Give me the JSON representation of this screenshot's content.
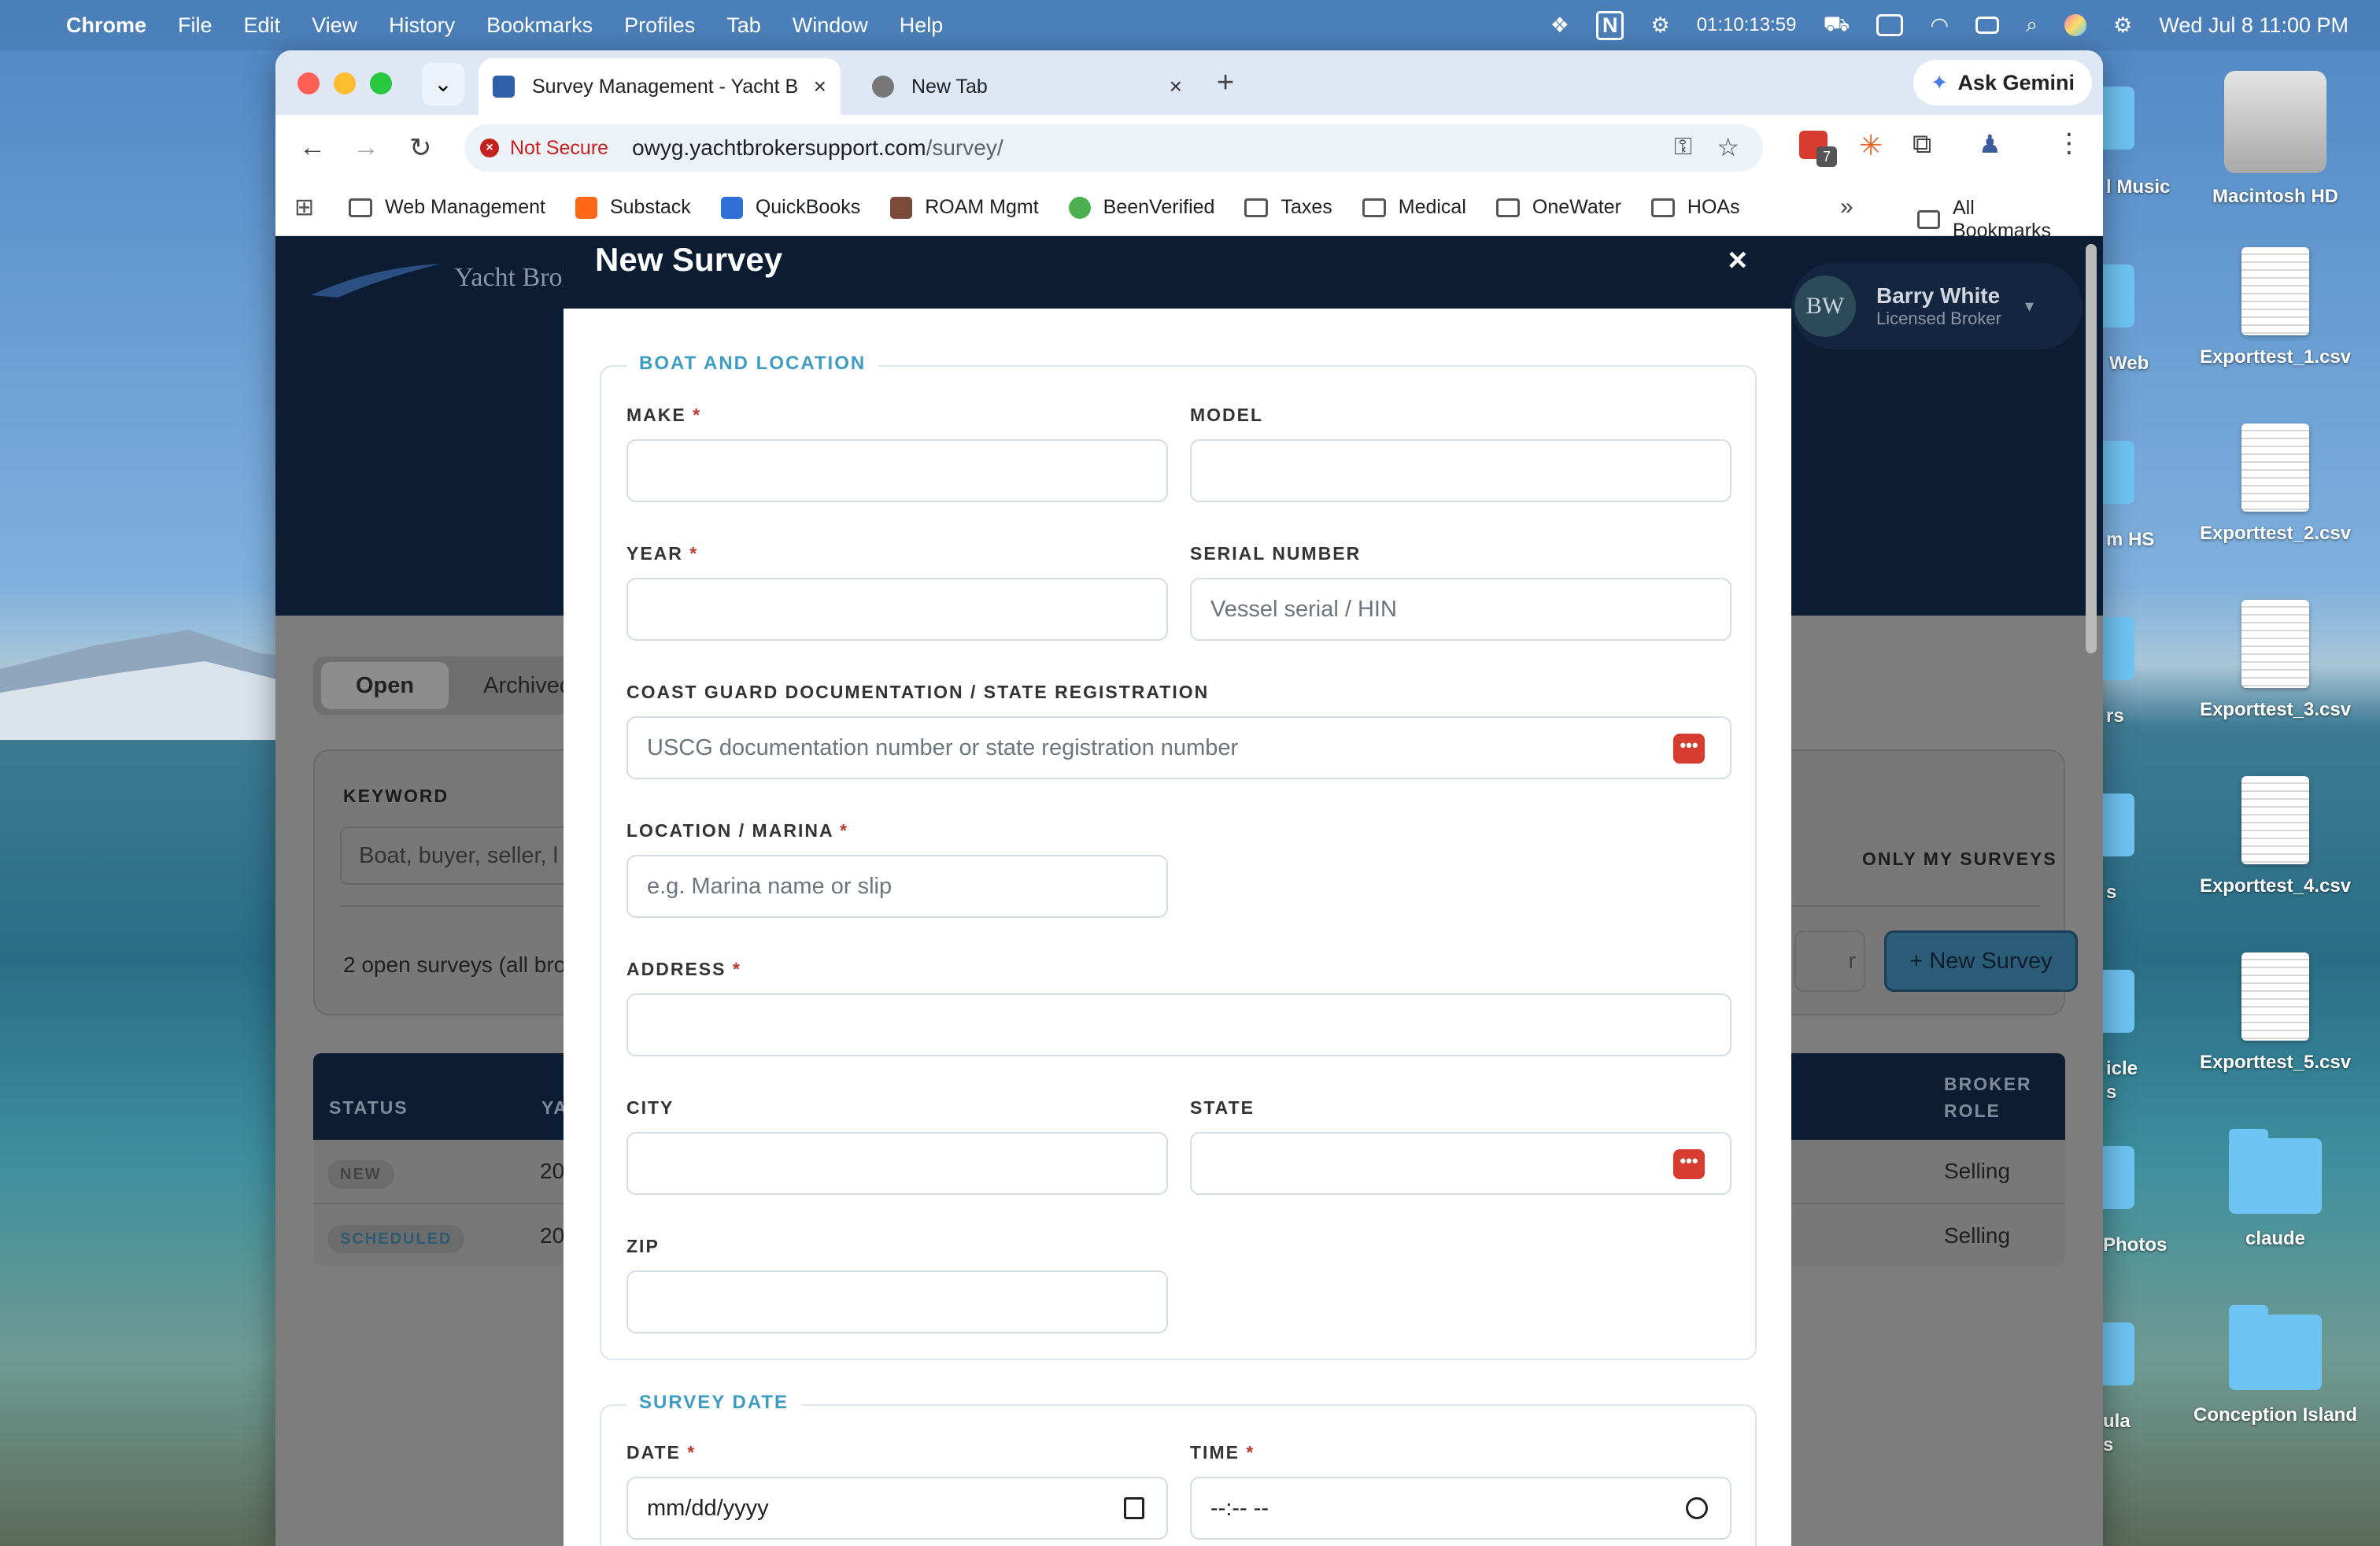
{
  "menubar": {
    "app": "Chrome",
    "items": [
      "File",
      "Edit",
      "View",
      "History",
      "Bookmarks",
      "Profiles",
      "Tab",
      "Window",
      "Help"
    ],
    "timer": "01:10:13:59",
    "datetime": "Wed Jul 8  11:00 PM"
  },
  "desktop": {
    "items": [
      {
        "label": "Macintosh HD",
        "icon": "hard-drive-icon"
      },
      {
        "label": "Exporttest_1.csv",
        "icon": "csv-file-icon"
      },
      {
        "label": "Exporttest_2.csv",
        "icon": "csv-file-icon"
      },
      {
        "label": "Exporttest_3.csv",
        "icon": "csv-file-icon"
      },
      {
        "label": "Exporttest_4.csv",
        "icon": "csv-file-icon"
      },
      {
        "label": "Exporttest_5.csv",
        "icon": "csv-file-icon"
      },
      {
        "label": "claude",
        "icon": "folder-icon"
      },
      {
        "label": "Conception Island",
        "icon": "folder-icon"
      }
    ],
    "peek_labels": [
      "l Music",
      "Web",
      "m HS",
      "rs",
      "s",
      "icle",
      "s",
      "Photos",
      "ula",
      "s"
    ]
  },
  "browser": {
    "tabs": [
      {
        "title": "Survey Management - Yacht B",
        "active": true
      },
      {
        "title": "New Tab",
        "active": false
      }
    ],
    "ask_gemini": "Ask Gemini",
    "security": "Not Secure",
    "url_host": "owyg.yachtbrokersupport.com",
    "url_path": "/survey/",
    "extension_badge": "7",
    "bookmarks": [
      {
        "label": "Web Management",
        "icon": "folder-icon"
      },
      {
        "label": "Substack",
        "icon": "substack-icon"
      },
      {
        "label": "QuickBooks",
        "icon": "quickbooks-icon"
      },
      {
        "label": "ROAM Mgmt",
        "icon": "roam-icon"
      },
      {
        "label": "BeenVerified",
        "icon": "beenverified-icon"
      },
      {
        "label": "Taxes",
        "icon": "folder-icon"
      },
      {
        "label": "Medical",
        "icon": "folder-icon"
      },
      {
        "label": "OneWater",
        "icon": "folder-icon"
      },
      {
        "label": "HOAs",
        "icon": "folder-icon"
      }
    ],
    "all_bookmarks": "All Bookmarks",
    "more_bookmarks": "»"
  },
  "background_page": {
    "brand": "Yacht Brol",
    "user": {
      "initials": "BW",
      "name": "Barry White",
      "role": "Licensed Broker"
    },
    "tabs": [
      "Open",
      "Archived"
    ],
    "keyword_label": "KEYWORD",
    "keyword_placeholder": "Boat, buyer, seller, l",
    "only_my_surveys": "ONLY MY SURVEYS",
    "count_text": "2 open surveys (all bro",
    "clear_partial": "r",
    "new_survey_button": "+ New Survey",
    "table": {
      "headers": {
        "status": "STATUS",
        "yacht": "YAC",
        "broker_role": "BROKER ROLE"
      },
      "rows": [
        {
          "status": "NEW",
          "year": "20",
          "broker_role": "Selling"
        },
        {
          "status": "SCHEDULED",
          "year": "20",
          "broker_role": "Selling"
        }
      ]
    }
  },
  "modal": {
    "title": "New Survey",
    "close": "×",
    "boat_section": {
      "legend": "BOAT AND LOCATION",
      "make": {
        "label": "MAKE",
        "value": "",
        "required": "*"
      },
      "model": {
        "label": "MODEL",
        "value": ""
      },
      "year": {
        "label": "YEAR",
        "value": "",
        "required": "*"
      },
      "serial": {
        "label": "SERIAL NUMBER",
        "placeholder": "Vessel serial / HIN"
      },
      "coast_guard": {
        "label": "COAST GUARD DOCUMENTATION / STATE REGISTRATION",
        "placeholder": "USCG documentation number or state registration number"
      },
      "location": {
        "label": "LOCATION / MARINA",
        "placeholder": "e.g. Marina name or slip",
        "required": "*"
      },
      "address": {
        "label": "ADDRESS",
        "value": "",
        "required": "*"
      },
      "city": {
        "label": "CITY",
        "value": ""
      },
      "state": {
        "label": "STATE",
        "value": ""
      },
      "zip": {
        "label": "ZIP",
        "value": ""
      }
    },
    "date_section": {
      "legend": "SURVEY DATE",
      "date": {
        "label": "DATE",
        "value": "mm/dd/yyyy",
        "required": "*"
      },
      "time": {
        "label": "TIME",
        "value": "--:-- --",
        "required": "*"
      }
    }
  }
}
